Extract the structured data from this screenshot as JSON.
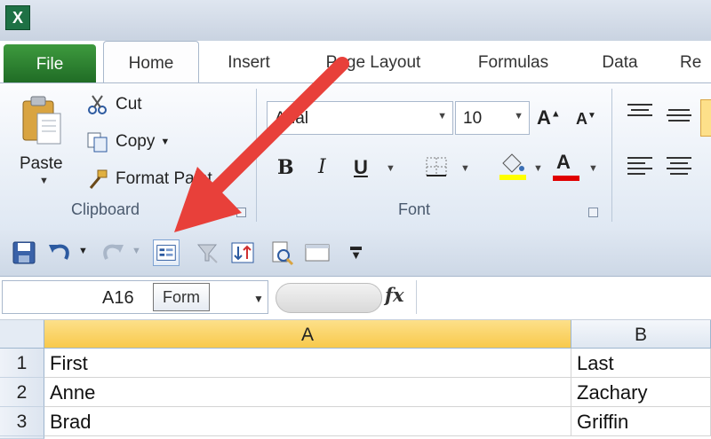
{
  "tabs": {
    "file": "File",
    "home": "Home",
    "insert": "Insert",
    "page_layout": "Page Layout",
    "formulas": "Formulas",
    "data": "Data",
    "review": "Re"
  },
  "clipboard": {
    "paste": "Paste",
    "cut": "Cut",
    "copy": "Copy",
    "format_painter": "Format Paint",
    "group_label": "Clipboard"
  },
  "font": {
    "name": "Arial",
    "size": "10",
    "group_label": "Font",
    "bold": "B",
    "italic": "I",
    "underline": "U",
    "grow": "A",
    "shrink": "A",
    "font_color_glyph": "A"
  },
  "formula_bar": {
    "name_box": "A16",
    "tooltip": "Form",
    "fx": "fx"
  },
  "grid": {
    "columns": [
      "A",
      "B"
    ],
    "rows": [
      {
        "num": "1",
        "a": "First",
        "b": "Last"
      },
      {
        "num": "2",
        "a": "Anne",
        "b": "Zachary"
      },
      {
        "num": "3",
        "a": "Brad",
        "b": "Griffin"
      }
    ]
  },
  "colors": {
    "arrow": "#e8403a",
    "file_tab": "#2a7d2e",
    "selected_column": "#f8c94c",
    "highlight_color": "#ffff00",
    "font_color": "#e00000"
  }
}
